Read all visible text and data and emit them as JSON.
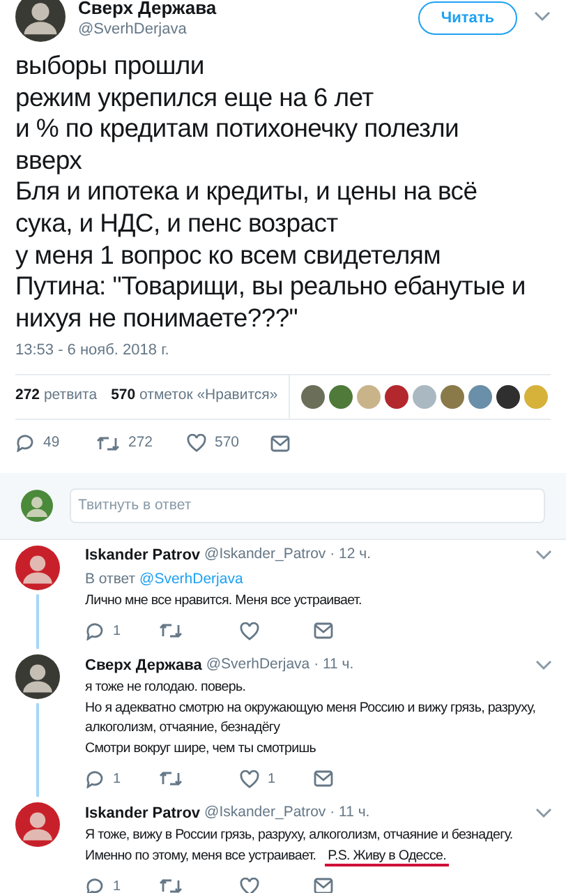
{
  "tweet": {
    "name": "Сверх Держава",
    "handle": "@SverhDerjava",
    "follow_button": "Читать",
    "lines": [
      "выборы прошли",
      "режим укрепился еще на 6 лет",
      "и % по кредитам потихонечку полезли",
      "вверх",
      "Бля и ипотека и кредиты, и цены на всё",
      "сука, и НДС, и пенс возраст",
      "у меня 1 вопрос ко всем свидетелям",
      "Путина: \"Товарищи, вы реально ебанутые и",
      "нихуя не понимаете???\""
    ],
    "timestamp": "13:53 - 6 нояб. 2018 г.",
    "stats": [
      {
        "count": "272",
        "label": "ретвита"
      },
      {
        "count": "570",
        "label": "отметок «Нравится»"
      }
    ],
    "liker_avatars": [
      {
        "color": "#6b6f5a"
      },
      {
        "color": "#4f7a3a"
      },
      {
        "color": "#c9b48a"
      },
      {
        "color": "#b3282d"
      },
      {
        "color": "#aab8c2"
      },
      {
        "color": "#8a7a4a"
      },
      {
        "color": "#6a8fa8"
      },
      {
        "color": "#2f2f2f"
      },
      {
        "color": "#d6b23a"
      }
    ],
    "actions": {
      "replies": "49",
      "retweets": "272",
      "likes": "570"
    }
  },
  "reply_box": {
    "placeholder": "Твитнуть в ответ"
  },
  "replies": [
    {
      "name": "Iskander Patrov",
      "handle": "@Iskander_Patrov",
      "time": "· 12 ч.",
      "color": "#c8202a",
      "reply_to_label": "В ответ",
      "reply_to": "@SverhDerjava",
      "lines": [
        [
          {
            "text": "Лично мне все нравится. Меня все устраивает.",
            "underlined": false
          }
        ]
      ],
      "actions": {
        "replies": "1"
      }
    },
    {
      "name": "Сверх Держава",
      "handle": "@SverhDerjava",
      "time": "· 11 ч.",
      "color": "#3a3a34",
      "lines": [
        [
          {
            "text": "я тоже не голодаю. поверь.",
            "underlined": false
          }
        ],
        [
          {
            "text": "Но я адекватно смотрю на окружающую меня Россию и вижу грязь, разруху,",
            "underlined": false
          }
        ],
        [
          {
            "text": "алкоголизм, отчаяние, безнадёгу",
            "underlined": false
          }
        ],
        [
          {
            "text": "Смотри вокруг шире, чем ты смотришь",
            "underlined": false
          }
        ]
      ],
      "actions": {
        "replies": "1",
        "likes": "1"
      }
    },
    {
      "name": "Iskander Patrov",
      "handle": "@Iskander_Patrov",
      "time": "· 11 ч.",
      "color": "#c8202a",
      "lines": [
        [
          {
            "text": "Я тоже, вижу в России грязь, разруху, алкоголизм, отчаяние и безнадегу.",
            "underlined": false
          }
        ],
        [
          {
            "text": "Именно по этому, меня все устраивает.",
            "underlined": false
          },
          {
            "text": "P.S. Живу в Одессе.",
            "underlined": true
          }
        ]
      ],
      "actions": {
        "replies": "1"
      }
    }
  ]
}
